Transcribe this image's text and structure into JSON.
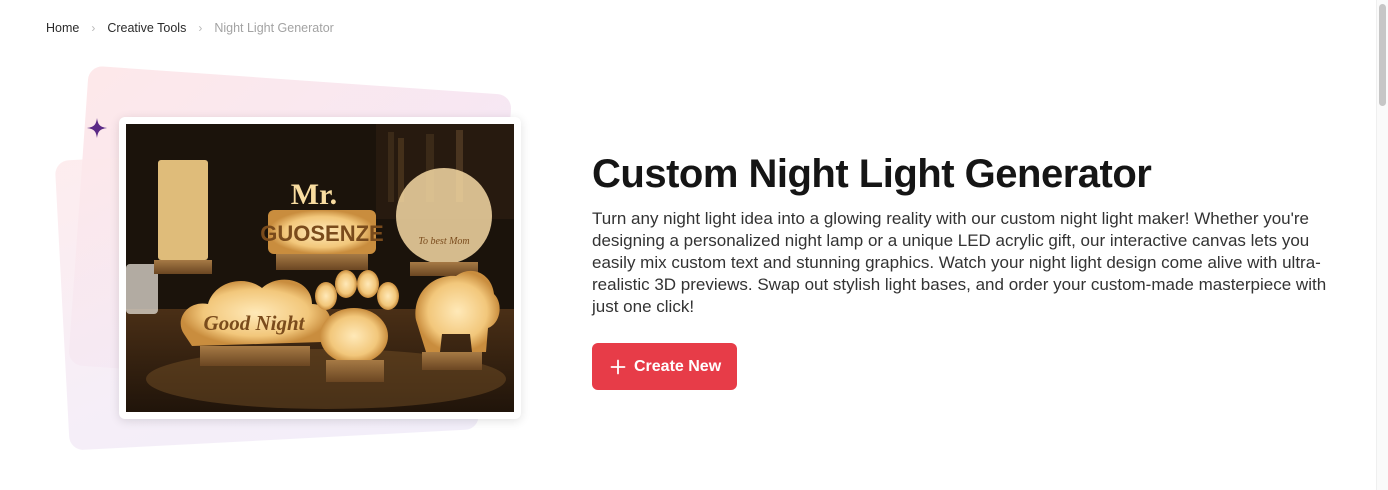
{
  "breadcrumb": {
    "items": [
      "Home",
      "Creative Tools",
      "Night Light Generator"
    ],
    "separator": "›"
  },
  "hero": {
    "image_alt": "Custom acrylic LED night lights",
    "photo_texts": {
      "sign_a": "GUOSENZE",
      "sign_b": "Good Night",
      "sign_c": "Mr.",
      "sign_d": "To best Mom"
    }
  },
  "main": {
    "title": "Custom Night Light Generator",
    "description": "Turn any night light idea into a glowing reality with our custom night light maker! Whether you're designing a personalized night lamp or a unique LED acrylic gift, our interactive canvas lets you easily mix custom text and stunning graphics. Watch your night light design come alive with ultra-realistic 3D previews. Swap out stylish light bases, and order your custom-made masterpiece with just one click!",
    "create_button": "Create New",
    "create_icon": "plus-icon"
  },
  "colors": {
    "accent": "#e73c48",
    "sparkle": "#5b2a86",
    "glow": "#f6d9a4"
  }
}
